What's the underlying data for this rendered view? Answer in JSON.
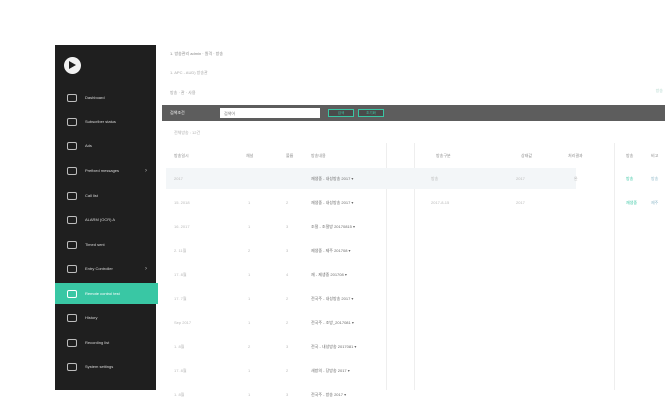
{
  "sidebar": {
    "items": [
      {
        "label": "Dashboard",
        "chevron": false,
        "active": false
      },
      {
        "label": "Subscriber status",
        "chevron": false,
        "active": false
      },
      {
        "label": "Ads",
        "chevron": false,
        "active": false
      },
      {
        "label": "Prefixed messages",
        "chevron": true,
        "active": false
      },
      {
        "label": "Call list",
        "chevron": false,
        "active": false
      },
      {
        "label": "ALARM (OCR) A",
        "chevron": false,
        "active": false
      },
      {
        "label": "Timed sent",
        "chevron": false,
        "active": false
      },
      {
        "label": "Entry Controller",
        "chevron": true,
        "active": false
      },
      {
        "label": "Remote control test",
        "chevron": false,
        "active": false
      },
      {
        "label": "History",
        "chevron": false,
        "active": false
      },
      {
        "label": "Recording list",
        "chevron": false,
        "active": false
      },
      {
        "label": "System settings",
        "chevron": false,
        "active": false
      }
    ]
  },
  "header": {
    "breadcrumb": "1. 방송관리 admin · 원격 · 방송",
    "subtitle": "1. APC - AUD) 방송관",
    "tabs": "방송 · 관 · 사용",
    "right_note": "방송"
  },
  "search": {
    "label": "검색조건",
    "placeholder": "검색어",
    "btn_search": "검색",
    "btn_reset": "초기화"
  },
  "count_text": "전체방송 : 12건",
  "columns": [
    "방송일시",
    "채널",
    "볼륨",
    "방송내용",
    "방송구분",
    "상태값",
    "처리결과",
    "방송",
    "비고"
  ],
  "rows": [
    {
      "date": "2017",
      "ch": "",
      "vol": "",
      "content": "재생중 - 내성방송 2017 ▾"
    },
    {
      "date": "15. 2018",
      "ch": "1",
      "vol": "2",
      "content": "재생중 - 내성방송 2017 ▾"
    },
    {
      "date": "16. 2017",
      "ch": "1",
      "vol": "3",
      "content": "조절 - 조절방 20170815 ▾"
    },
    {
      "date": "2. 11월",
      "ch": "2",
      "vol": "3",
      "content": "제생중 - 제주 201708 ▾"
    },
    {
      "date": "17. 8월",
      "ch": "1",
      "vol": "4",
      "content": "재 - 제생중 201708 ▾"
    },
    {
      "date": "17. 7월",
      "ch": "1",
      "vol": "2",
      "content": "전국주 - 내성방송 2017 ▾"
    },
    {
      "date": "Sep 2017",
      "ch": "1",
      "vol": "2",
      "content": "전국주 - 조방_2017081 ▾"
    },
    {
      "date": "1. 8월",
      "ch": "2",
      "vol": "3",
      "content": "전국 - 내성방송 2017081 ▾"
    },
    {
      "date": "17. 8월",
      "ch": "1",
      "vol": "2",
      "content": "새방의 - 당방송 2017 ▾"
    },
    {
      "date": "1. 8월",
      "ch": "1",
      "vol": "3",
      "content": "전국주 - 방송 2017 ▾"
    }
  ],
  "detail": [
    {
      "type": "방송",
      "status": "2017",
      "result": "완"
    },
    {
      "type": "2017-8-15",
      "status": "2017",
      "result": ""
    }
  ],
  "right_panel": {
    "labels": [
      "방송",
      "방송",
      "재생중",
      "제주"
    ]
  },
  "colors": {
    "sidebar_bg": "#1f1f1f",
    "accent": "#39c7a4",
    "search_bar": "#5d5d5d"
  }
}
